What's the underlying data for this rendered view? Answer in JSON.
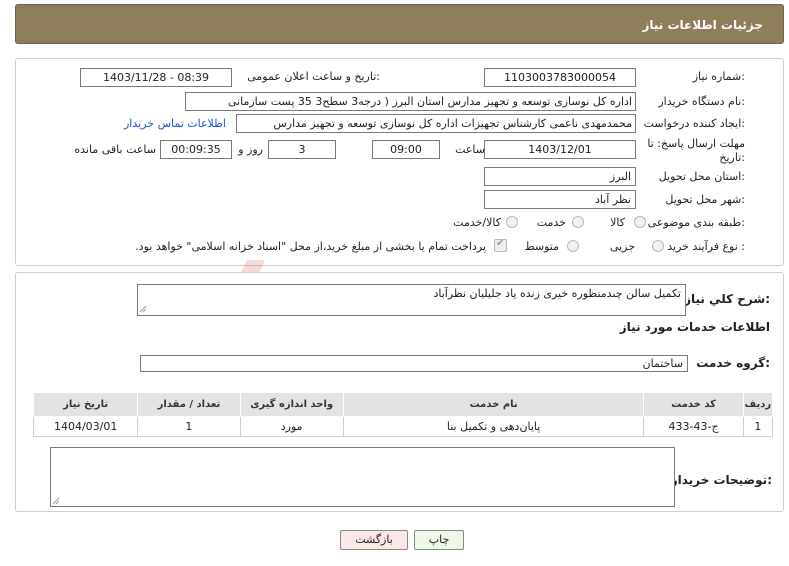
{
  "header": {
    "title": "جزئیات اطلاعات نیاز"
  },
  "form": {
    "need_number_label": "شماره نیاز:",
    "need_number": "1103003783000054",
    "announce_label": "تاریخ و ساعت اعلان عمومی:",
    "announce_value": "1403/11/28 - 08:39",
    "buyer_label": "نام دستگاه خریدار:",
    "buyer_value": "اداره کل نوسازی   توسعه و تجهیز مدارس استان البرز ( درجه3  سطح3  35 پست سازمانی",
    "creator_label": "ایجاد کننده درخواست:",
    "creator_value": "محمدمهدی ناعمی کارشناس تجهیزات اداره کل نوسازی   توسعه و تجهیز مدارس",
    "contact_link": "اطلاعات تماس خریدار",
    "deadline_label": "مهلت ارسال پاسخ: تا تاریخ:",
    "deadline_date": "1403/12/01",
    "time_label": "ساعت",
    "deadline_time": "09:00",
    "days_value": "3",
    "days_label": "روز و",
    "remaining_time": "00:09:35",
    "remaining_label": "ساعت باقی مانده",
    "province_label": "استان محل تحویل:",
    "province_value": "البرز",
    "city_label": "شهر محل تحویل:",
    "city_value": "نظر آباد",
    "category_label": "طبقه بندی موضوعی:",
    "category_options": [
      "کالا",
      "خدمت",
      "کالا/خدمت"
    ],
    "process_label": "نوع فرآیند خرید :",
    "process_options": [
      "جزیی",
      "متوسط"
    ],
    "payment_note": "پرداخت تمام یا بخشی از مبلغ خرید،از محل \"اسناد خزانه اسلامی\" خواهد بود."
  },
  "details": {
    "summary_label": "شرح کلي نياز:",
    "summary_value": "تکمیل سالن چندمنظوره خیری زنده یاد جلیلیان نظرآباد",
    "services_title": "اطلاعات خدمات مورد نیاز",
    "group_label": "گروه خدمت:",
    "group_value": "ساختمان",
    "table": {
      "headers": [
        "ردیف",
        "کد خدمت",
        "نام خدمت",
        "واحد اندازه گیری",
        "تعداد / مقدار",
        "تاریخ نیاز"
      ],
      "rows": [
        [
          "1",
          "ج-43-433",
          "پایان‌دهی و تکمیل بنا",
          "مورد",
          "1",
          "1404/03/01"
        ]
      ]
    },
    "buyer_notes_label": "توضیحات خریدار:"
  },
  "buttons": {
    "print": "چاپ",
    "back": "بازگشت"
  },
  "watermark": {
    "text": "AriaTender.neT"
  },
  "colors": {
    "header": "#8e7e5c",
    "link": "#1a55c9",
    "back_button": "#fde8e8",
    "print_button": "#eef8e6"
  }
}
